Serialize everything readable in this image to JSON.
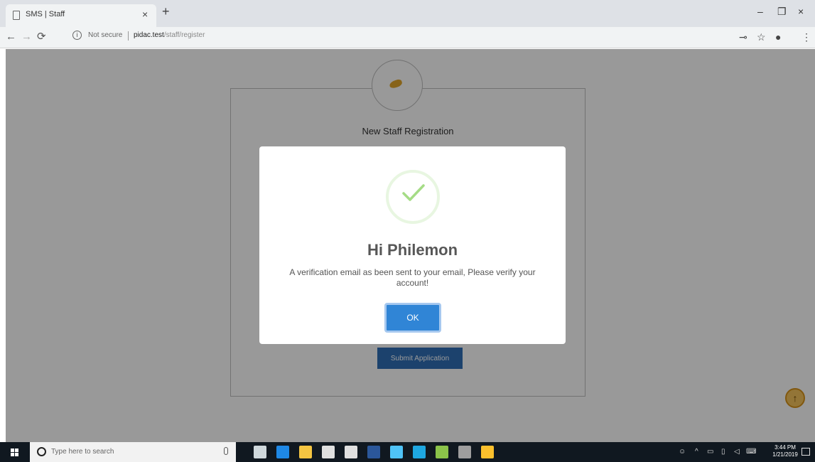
{
  "browser": {
    "tab_title": "SMS | Staff",
    "tab_close": "×",
    "new_tab": "+",
    "window_controls": {
      "minimize": "–",
      "restore": "❐",
      "close": "×"
    },
    "nav": {
      "back": "←",
      "forward": "→",
      "reload": "⟳"
    },
    "security_label": "Not secure",
    "url_host": "pidac.test",
    "url_path": "/staff/register",
    "key_icon": "⊸",
    "star_icon": "☆",
    "account_icon": "●",
    "menu_icon": "⋮"
  },
  "page": {
    "registration_title": "New Staff Registration",
    "submit_label": "Submit Application",
    "scroll_top_icon": "↑"
  },
  "modal": {
    "title": "Hi Philemon",
    "message": "A verification email as been sent to your email, Please verify your account!",
    "ok_label": "OK"
  },
  "taskbar": {
    "search_placeholder": "Type here to search",
    "time": "3:44 PM",
    "date": "1/21/2019",
    "apps": [
      {
        "name": "task-view",
        "color": "#cfd8dc"
      },
      {
        "name": "edge",
        "color": "#1e88e5"
      },
      {
        "name": "file-explorer",
        "color": "#f4c542"
      },
      {
        "name": "store",
        "color": "#e0e0e0"
      },
      {
        "name": "mail",
        "color": "#e0e0e0"
      },
      {
        "name": "word",
        "color": "#2b579a"
      },
      {
        "name": "photos",
        "color": "#4fc3f7"
      },
      {
        "name": "app-blue",
        "color": "#1ea7e1"
      },
      {
        "name": "app-green",
        "color": "#8bc34a"
      },
      {
        "name": "app-gray",
        "color": "#9e9e9e"
      },
      {
        "name": "chrome",
        "color": "#fbc02d"
      }
    ]
  },
  "colors": {
    "ok_button": "#3085d6",
    "success_check": "#a5dc86",
    "submit_button": "#2f6fb6",
    "logo_accent": "#e2a62a"
  }
}
